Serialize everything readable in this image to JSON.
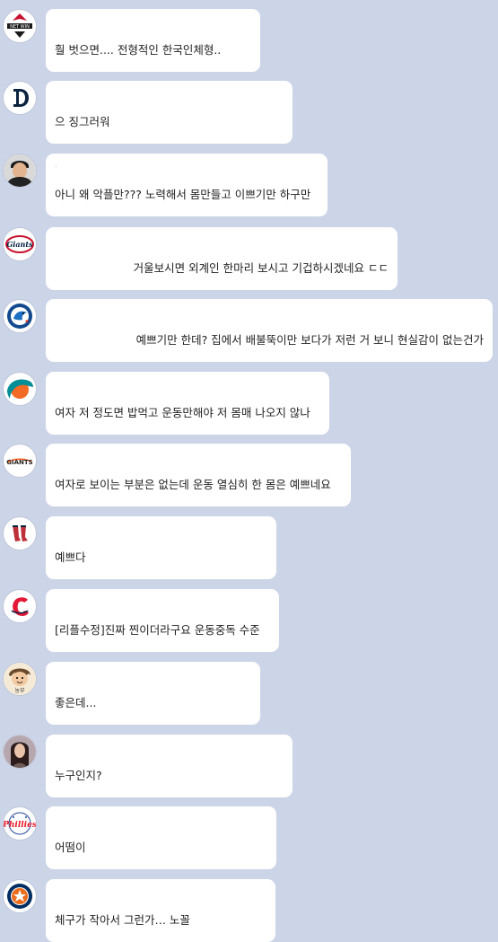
{
  "messages": [
    {
      "avatar": "netwin-logo-icon",
      "text": "훨 벗으면.... 전형적인 한국인체형..",
      "align": "left"
    },
    {
      "avatar": "tigers-d-logo-icon",
      "text": "으 징그러워",
      "align": "left"
    },
    {
      "avatar": "player-photo-icon",
      "text": "아니 왜 악플만??? 노력해서 몸만들고 이쁘기만 하구만",
      "align": "left"
    },
    {
      "avatar": "giants-logo-icon",
      "text": "거울보시면 외계인 한마리 보시고 기겁하시겠네요 ㄷㄷ",
      "align": "right"
    },
    {
      "avatar": "blue-jays-logo-icon",
      "text": "예쁘기만 한데? 집에서 배불뚝이만 보다가 저런 거 보니 현실감이 없는건가",
      "align": "right"
    },
    {
      "avatar": "dolphins-logo-icon",
      "text": "여자 저 정도면 밥먹고 운동만해야 저 몸매 나오지 않나",
      "align": "left"
    },
    {
      "avatar": "sf-giants-logo-icon",
      "text": "여자로 보이는 부분은 없는데 운동 열심히 한 몸은 예쁘네요",
      "align": "left"
    },
    {
      "avatar": "red-sox-logo-icon",
      "text": "예쁘다",
      "align": "left"
    },
    {
      "avatar": "guardians-logo-icon",
      "text": "[리플수정]진짜 찐이더라구요 운동중독 수준",
      "align": "left"
    },
    {
      "avatar": "cartoon-face-icon",
      "text": "좋은데...",
      "align": "left"
    },
    {
      "avatar": "woman-photo-icon",
      "text": "누구인지?",
      "align": "left"
    },
    {
      "avatar": "phillies-logo-icon",
      "text": "어떰이",
      "align": "left"
    },
    {
      "avatar": "astros-logo-icon",
      "text": "체구가 작아서 그런가… 노꼴",
      "align": "left"
    }
  ],
  "colors": {
    "background": "#ccd4e8",
    "bubble": "#ffffff",
    "text": "#222222"
  }
}
